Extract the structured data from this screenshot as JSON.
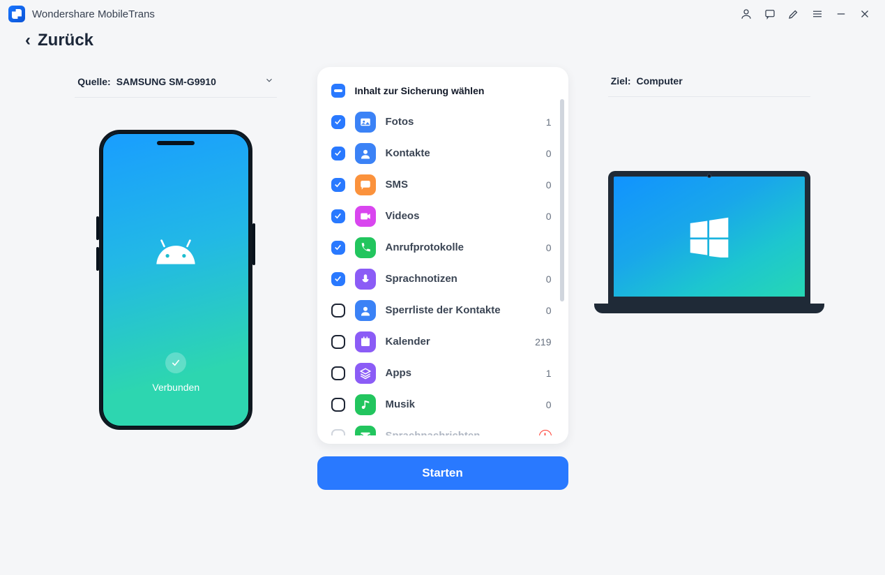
{
  "app": {
    "title": "Wondershare MobileTrans"
  },
  "nav": {
    "back": "Zurück"
  },
  "source": {
    "label": "Quelle:",
    "device": "SAMSUNG SM-G9910"
  },
  "target": {
    "label": "Ziel:",
    "device": "Computer"
  },
  "phone": {
    "status": "Verbunden"
  },
  "panel": {
    "header": "Inhalt zur Sicherung wählen",
    "items": [
      {
        "id": "fotos",
        "label": "Fotos",
        "count": "1",
        "checked": true,
        "icon": "photo",
        "color": "#3b82f6"
      },
      {
        "id": "kontakte",
        "label": "Kontakte",
        "count": "0",
        "checked": true,
        "icon": "contact",
        "color": "#3b82f6"
      },
      {
        "id": "sms",
        "label": "SMS",
        "count": "0",
        "checked": true,
        "icon": "sms",
        "color": "#fb923c"
      },
      {
        "id": "videos",
        "label": "Videos",
        "count": "0",
        "checked": true,
        "icon": "video",
        "color": "#d946ef"
      },
      {
        "id": "anruf",
        "label": "Anrufprotokolle",
        "count": "0",
        "checked": true,
        "icon": "call",
        "color": "#22c55e"
      },
      {
        "id": "sprachnot",
        "label": "Sprachnotizen",
        "count": "0",
        "checked": true,
        "icon": "mic",
        "color": "#8b5cf6"
      },
      {
        "id": "sperrliste",
        "label": "Sperrliste der Kontakte",
        "count": "0",
        "checked": false,
        "icon": "contact",
        "color": "#3b82f6"
      },
      {
        "id": "kalender",
        "label": "Kalender",
        "count": "219",
        "checked": false,
        "icon": "cal",
        "color": "#8b5cf6"
      },
      {
        "id": "apps",
        "label": "Apps",
        "count": "1",
        "checked": false,
        "icon": "apps",
        "color": "#8b5cf6"
      },
      {
        "id": "musik",
        "label": "Musik",
        "count": "0",
        "checked": false,
        "icon": "music",
        "color": "#22c55e"
      },
      {
        "id": "sprachnachr",
        "label": "Sprachnachrichten",
        "count": "",
        "checked": false,
        "icon": "voicemsg",
        "color": "#22c55e",
        "disabled": true,
        "error": true
      }
    ]
  },
  "action": {
    "start": "Starten"
  }
}
